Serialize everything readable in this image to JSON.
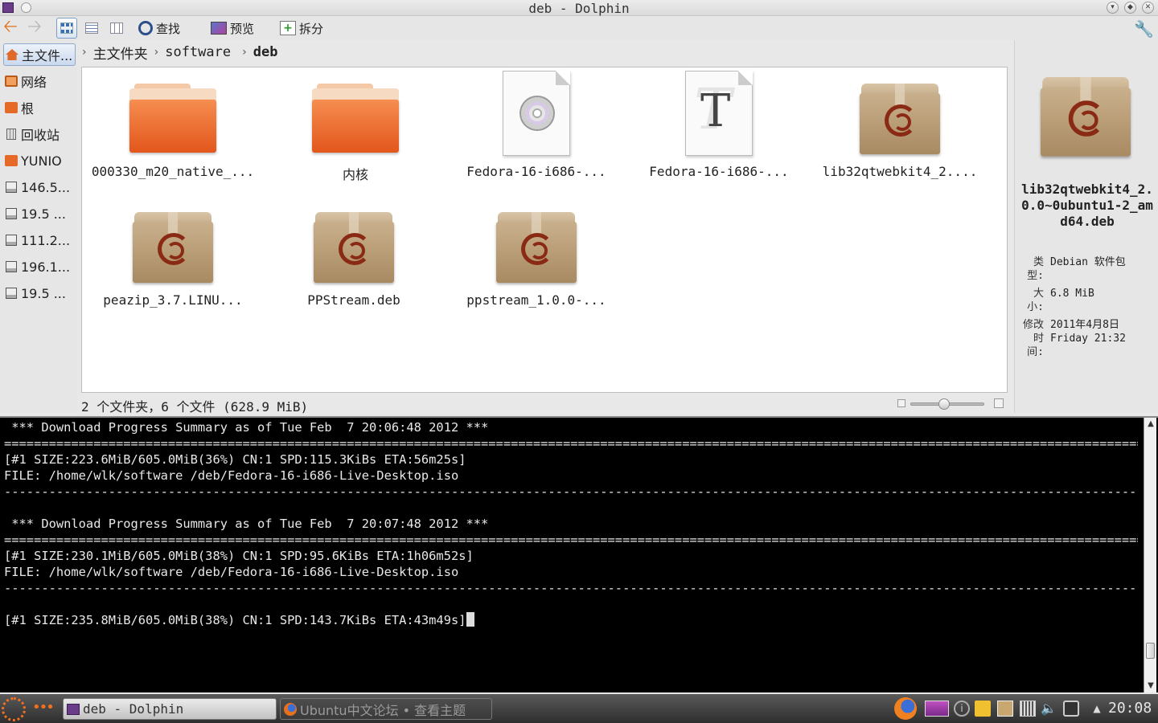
{
  "window": {
    "title": "deb - Dolphin"
  },
  "toolbar": {
    "find_label": "查找",
    "preview_label": "预览",
    "split_label": "拆分"
  },
  "breadcrumb": [
    {
      "label": "主文件夹"
    },
    {
      "label": "software"
    },
    {
      "label": "deb"
    }
  ],
  "places": [
    {
      "label": "主文件...",
      "icon": "home-icon"
    },
    {
      "label": "网络",
      "icon": "network-icon"
    },
    {
      "label": "根",
      "icon": "folder-icon"
    },
    {
      "label": "回收站",
      "icon": "trash-icon"
    },
    {
      "label": "YUNIO",
      "icon": "folder-icon"
    },
    {
      "label": "146.5...",
      "icon": "disk-icon"
    },
    {
      "label": "19.5 ...",
      "icon": "disk-icon"
    },
    {
      "label": "111.2...",
      "icon": "disk-icon"
    },
    {
      "label": "196.1...",
      "icon": "disk-icon"
    },
    {
      "label": "19.5 ...",
      "icon": "disk-icon"
    }
  ],
  "files": [
    {
      "name": "000330_m20_native_...",
      "kind": "folder"
    },
    {
      "name": "内核",
      "kind": "folder"
    },
    {
      "name": "Fedora-16-i686-...",
      "kind": "iso"
    },
    {
      "name": "Fedora-16-i686-...",
      "kind": "font"
    },
    {
      "name": "lib32qtwebkit4_2....",
      "kind": "deb"
    },
    {
      "name": "peazip_3.7.LINU...",
      "kind": "deb"
    },
    {
      "name": "PPStream.deb",
      "kind": "deb"
    },
    {
      "name": "ppstream_1.0.0-...",
      "kind": "deb"
    }
  ],
  "status": {
    "summary": "2 个文件夹，6 个文件 (628.9 MiB)",
    "zoom_level": 0.45
  },
  "info": {
    "name": "lib32qtwebkit4_2.0.0~0ubuntu1-2_amd64.deb",
    "type_label": "类型:",
    "type_value": "Debian 软件包",
    "size_label": "大小:",
    "size_value": "6.8 MiB",
    "modified_label": "修改时间:",
    "modified_value": "2011年4月8日 Friday 21:32"
  },
  "terminal": {
    "lines": [
      " *** Download Progress Summary as of Tue Feb  7 20:06:48 2012 ***",
      "=========================================================================================================================================================",
      "[#1 SIZE:223.6MiB/605.0MiB(36%) CN:1 SPD:115.3KiBs ETA:56m25s]",
      "FILE: /home/wlk/software /deb/Fedora-16-i686-Live-Desktop.iso",
      "---------------------------------------------------------------------------------------------------------------------------------------------------------",
      "",
      " *** Download Progress Summary as of Tue Feb  7 20:07:48 2012 ***",
      "=========================================================================================================================================================",
      "[#1 SIZE:230.1MiB/605.0MiB(38%) CN:1 SPD:95.6KiBs ETA:1h06m52s]",
      "FILE: /home/wlk/software /deb/Fedora-16-i686-Live-Desktop.iso",
      "---------------------------------------------------------------------------------------------------------------------------------------------------------",
      "",
      "[#1 SIZE:235.8MiB/605.0MiB(38%) CN:1 SPD:143.7KiBs ETA:43m49s]"
    ]
  },
  "taskbar": {
    "tasks": [
      {
        "label": "deb - Dolphin"
      },
      {
        "label": "Ubuntu中文论坛 • 查看主题"
      }
    ],
    "clock": "20:08"
  }
}
